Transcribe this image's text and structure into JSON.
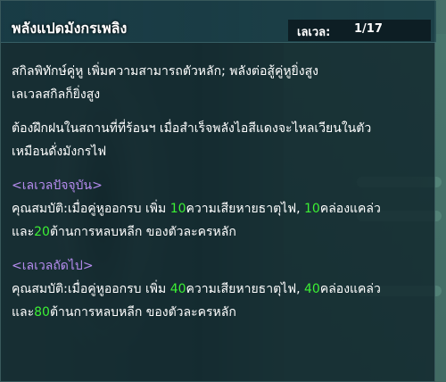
{
  "skill": {
    "title": "พลังแปดมังกรเพลิง",
    "level_label": "เลเวล:",
    "level_value": "1/17"
  },
  "description": {
    "line1": "สกิลพิทักษ์คู่หู เพิ่มความสามารถตัวหลัก; พลังต่อสู้คู่หูยิ่งสูง",
    "line2": "เลเวลสกิลก็ยิ่งสูง",
    "line3": "ต้องฝึกฝนในสถานที่ที่ร้อนฯ เมื่อสำเร็จพลังไอสีแดงจะไหลเวียนในตัว",
    "line4": "เหมือนดั่งมังกรไฟ"
  },
  "current": {
    "heading": "<เลเวลปัจจุบัน>",
    "prefix": "คุณสมบัติ:เมื่อคู่หูออกรบ เพิ่ม ",
    "fire_dmg": "10",
    "mid1": "ความเสียหายธาตุไฟ, ",
    "agility": "10",
    "mid2": "คล่องแคล่ว",
    "line2_prefix": "และ",
    "evasion": "20",
    "suffix": "ต้านการหลบหลีก ของตัวละครหลัก"
  },
  "next": {
    "heading": "<เลเวลถัดไป>",
    "prefix": "คุณสมบัติ:เมื่อคู่หูออกรบ เพิ่ม ",
    "fire_dmg": "40",
    "mid1": "ความเสียหายธาตุไฟ, ",
    "agility": "40",
    "mid2": "คล่องแคล่ว",
    "line2_prefix": "และ",
    "evasion": "80",
    "suffix": "ต้านการหลบหลีก ของตัวละครหลัก"
  },
  "colors": {
    "heading": "#b68cf0",
    "value_highlight": "#3cf034"
  }
}
